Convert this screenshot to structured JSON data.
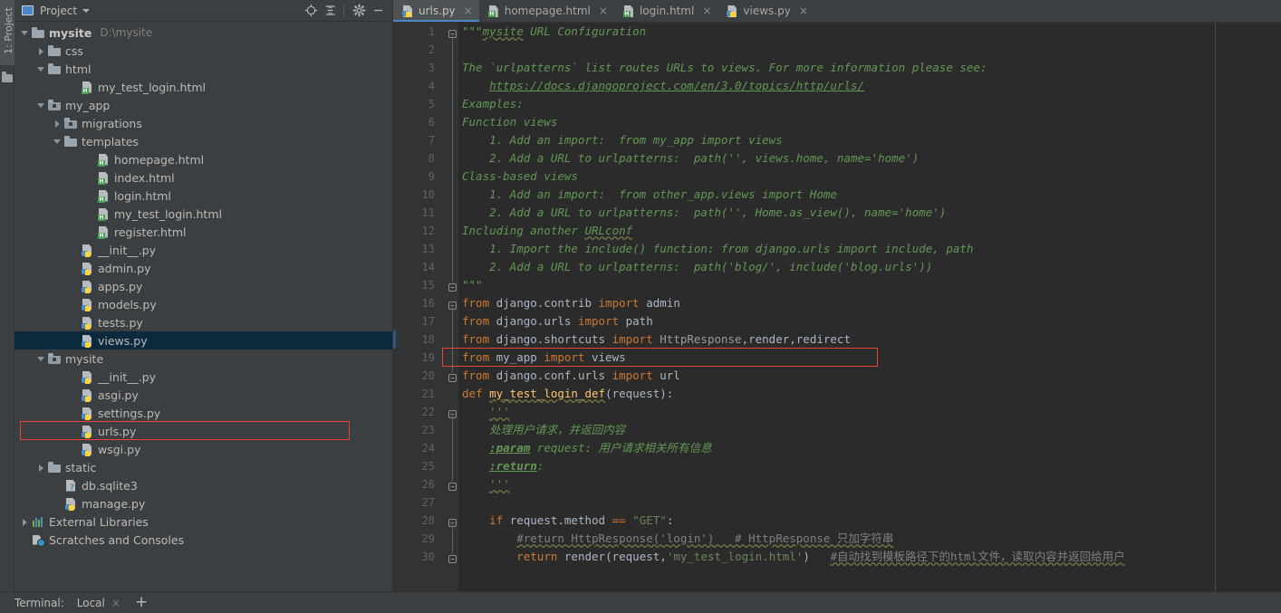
{
  "toolwindow": {
    "vertical_tab": "1: Project",
    "title": "Project",
    "icons": {
      "window": "project-window-icon",
      "dropdown": "chevron-down-icon",
      "locate": "locate-target-icon",
      "collapse": "collapse-all-icon",
      "settings": "gear-icon",
      "hide": "minimize-icon"
    }
  },
  "tree": [
    {
      "label": "mysite",
      "sub": "D:\\mysite",
      "icon": "folder",
      "indent": 0,
      "arrow": "expanded",
      "bold": true
    },
    {
      "label": "css",
      "sub": "",
      "icon": "folder",
      "indent": 1,
      "arrow": "collapsed",
      "bold": false
    },
    {
      "label": "html",
      "sub": "",
      "icon": "folder",
      "indent": 1,
      "arrow": "expanded",
      "bold": false
    },
    {
      "label": "my_test_login.html",
      "sub": "",
      "icon": "html",
      "indent": 3,
      "arrow": "none",
      "bold": false
    },
    {
      "label": "my_app",
      "sub": "",
      "icon": "folder-module",
      "indent": 1,
      "arrow": "expanded",
      "bold": false
    },
    {
      "label": "migrations",
      "sub": "",
      "icon": "folder-module",
      "indent": 2,
      "arrow": "collapsed",
      "bold": false
    },
    {
      "label": "templates",
      "sub": "",
      "icon": "folder",
      "indent": 2,
      "arrow": "expanded",
      "bold": false
    },
    {
      "label": "homepage.html",
      "sub": "",
      "icon": "html",
      "indent": 4,
      "arrow": "none",
      "bold": false
    },
    {
      "label": "index.html",
      "sub": "",
      "icon": "html",
      "indent": 4,
      "arrow": "none",
      "bold": false
    },
    {
      "label": "login.html",
      "sub": "",
      "icon": "html",
      "indent": 4,
      "arrow": "none",
      "bold": false
    },
    {
      "label": "my_test_login.html",
      "sub": "",
      "icon": "html",
      "indent": 4,
      "arrow": "none",
      "bold": false
    },
    {
      "label": "register.html",
      "sub": "",
      "icon": "html",
      "indent": 4,
      "arrow": "none",
      "bold": false
    },
    {
      "label": "__init__.py",
      "sub": "",
      "icon": "py",
      "indent": 3,
      "arrow": "none",
      "bold": false
    },
    {
      "label": "admin.py",
      "sub": "",
      "icon": "py",
      "indent": 3,
      "arrow": "none",
      "bold": false
    },
    {
      "label": "apps.py",
      "sub": "",
      "icon": "py",
      "indent": 3,
      "arrow": "none",
      "bold": false
    },
    {
      "label": "models.py",
      "sub": "",
      "icon": "py",
      "indent": 3,
      "arrow": "none",
      "bold": false
    },
    {
      "label": "tests.py",
      "sub": "",
      "icon": "py",
      "indent": 3,
      "arrow": "none",
      "bold": false
    },
    {
      "label": "views.py",
      "sub": "",
      "icon": "py",
      "indent": 3,
      "arrow": "none",
      "bold": false,
      "selected": true
    },
    {
      "label": "mysite",
      "sub": "",
      "icon": "folder-module",
      "indent": 1,
      "arrow": "expanded",
      "bold": false
    },
    {
      "label": "__init__.py",
      "sub": "",
      "icon": "py",
      "indent": 3,
      "arrow": "none",
      "bold": false
    },
    {
      "label": "asgi.py",
      "sub": "",
      "icon": "py",
      "indent": 3,
      "arrow": "none",
      "bold": false
    },
    {
      "label": "settings.py",
      "sub": "",
      "icon": "py",
      "indent": 3,
      "arrow": "none",
      "bold": false
    },
    {
      "label": "urls.py",
      "sub": "",
      "icon": "py",
      "indent": 3,
      "arrow": "none",
      "bold": false,
      "highlighted": true
    },
    {
      "label": "wsgi.py",
      "sub": "",
      "icon": "py",
      "indent": 3,
      "arrow": "none",
      "bold": false
    },
    {
      "label": "static",
      "sub": "",
      "icon": "folder",
      "indent": 1,
      "arrow": "collapsed",
      "bold": false
    },
    {
      "label": "db.sqlite3",
      "sub": "",
      "icon": "db",
      "indent": 2,
      "arrow": "none",
      "bold": false
    },
    {
      "label": "manage.py",
      "sub": "",
      "icon": "py",
      "indent": 2,
      "arrow": "none",
      "bold": false
    },
    {
      "label": "External Libraries",
      "sub": "",
      "icon": "library",
      "indent": 0,
      "arrow": "collapsed",
      "bold": false
    },
    {
      "label": "Scratches and Consoles",
      "sub": "",
      "icon": "scratch",
      "indent": 0,
      "arrow": "none",
      "bold": false
    }
  ],
  "tabs": [
    {
      "label": "urls.py",
      "icon": "py",
      "active": true,
      "close": "×"
    },
    {
      "label": "homepage.html",
      "icon": "html",
      "active": false,
      "close": "×"
    },
    {
      "label": "login.html",
      "icon": "html",
      "active": false,
      "close": "×"
    },
    {
      "label": "views.py",
      "icon": "py",
      "active": false,
      "close": "×"
    }
  ],
  "code_lines": [
    {
      "n": 1,
      "text": "\"\"\"mysite URL Configuration"
    },
    {
      "n": 2,
      "text": ""
    },
    {
      "n": 3,
      "text": "The `urlpatterns` list routes URLs to views. For more information please see:"
    },
    {
      "n": 4,
      "text": "    https://docs.djangoproject.com/en/3.0/topics/http/urls/"
    },
    {
      "n": 5,
      "text": "Examples:"
    },
    {
      "n": 6,
      "text": "Function views"
    },
    {
      "n": 7,
      "text": "    1. Add an import:  from my_app import views"
    },
    {
      "n": 8,
      "text": "    2. Add a URL to urlpatterns:  path('', views.home, name='home')"
    },
    {
      "n": 9,
      "text": "Class-based views"
    },
    {
      "n": 10,
      "text": "    1. Add an import:  from other_app.views import Home"
    },
    {
      "n": 11,
      "text": "    2. Add a URL to urlpatterns:  path('', Home.as_view(), name='home')"
    },
    {
      "n": 12,
      "text": "Including another URLconf"
    },
    {
      "n": 13,
      "text": "    1. Import the include() function: from django.urls import include, path"
    },
    {
      "n": 14,
      "text": "    2. Add a URL to urlpatterns:  path('blog/', include('blog.urls'))"
    },
    {
      "n": 15,
      "text": "\"\"\""
    },
    {
      "n": 16,
      "text": "from django.contrib import admin"
    },
    {
      "n": 17,
      "text": "from django.urls import path"
    },
    {
      "n": 18,
      "text": "from django.shortcuts import HttpResponse,render,redirect"
    },
    {
      "n": 19,
      "text": "from my_app import views"
    },
    {
      "n": 20,
      "text": "from django.conf.urls import url"
    },
    {
      "n": 21,
      "text": "def my_test_login_def(request):"
    },
    {
      "n": 22,
      "text": "    '''"
    },
    {
      "n": 23,
      "text": "    处理用户请求，并返回内容"
    },
    {
      "n": 24,
      "text": "    :param request: 用户请求相关所有信息"
    },
    {
      "n": 25,
      "text": "    :return:"
    },
    {
      "n": 26,
      "text": "    '''"
    },
    {
      "n": 27,
      "text": ""
    },
    {
      "n": 28,
      "text": "    if request.method == \"GET\":"
    },
    {
      "n": 29,
      "text": "        #return HttpResponse('login')   # HttpResponse 只加字符串"
    },
    {
      "n": 30,
      "text": "        return render(request,'my_test_login.html')   #自动找到模板路径下的html文件，读取内容并返回给用户"
    }
  ],
  "statusbar": {
    "label": "Terminal:",
    "tab": "Local",
    "close": "×",
    "add": "+"
  },
  "colors": {
    "background": "#3c3f41",
    "editor_background": "#2b2b2b",
    "gutter": "#313335",
    "selection": "#0d293e",
    "annotation": "#e8443a",
    "keyword": "#cc7832",
    "docstring": "#629755",
    "string": "#6a8759",
    "comment": "#808080",
    "function": "#ffc66d",
    "accent": "#4a88c7"
  }
}
